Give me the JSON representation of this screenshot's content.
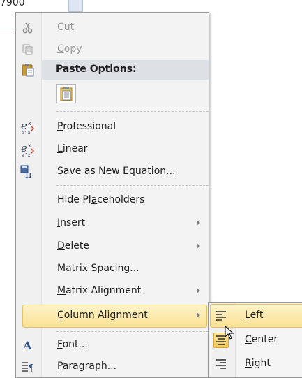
{
  "background": {
    "cell_text": "7900"
  },
  "menu": {
    "items": [
      {
        "id": "cut",
        "label": "Cut",
        "accel": "t",
        "disabled": true,
        "icon": "scissors-icon"
      },
      {
        "id": "copy",
        "label": "Copy",
        "accel": "C",
        "disabled": true,
        "icon": "copy-icon"
      },
      {
        "id": "paste_options",
        "label": "Paste Options:",
        "icon": "clipboard-icon"
      },
      {
        "id": "professional",
        "label": "Professional",
        "accel": "P",
        "icon": "equation-professional-icon"
      },
      {
        "id": "linear",
        "label": "Linear",
        "accel": "L",
        "icon": "equation-linear-icon"
      },
      {
        "id": "save_eq",
        "label": "Save as New Equation...",
        "accel": "S",
        "icon": "save-equation-icon"
      },
      {
        "id": "hide_placeholders",
        "label": "Hide Placeholders",
        "accel": "a"
      },
      {
        "id": "insert",
        "label": "Insert",
        "accel": "I",
        "submenu": true
      },
      {
        "id": "delete",
        "label": "Delete",
        "accel": "D",
        "submenu": true
      },
      {
        "id": "matrix_spacing",
        "label": "Matrix Spacing...",
        "accel": "x"
      },
      {
        "id": "matrix_alignment",
        "label": "Matrix Alignment",
        "accel": "M",
        "submenu": true
      },
      {
        "id": "column_alignment",
        "label": "Column Alignment",
        "accel": "C",
        "submenu": true,
        "highlighted": true
      },
      {
        "id": "font",
        "label": "Font...",
        "accel": "F",
        "icon": "font-icon"
      },
      {
        "id": "paragraph",
        "label": "Paragraph...",
        "accel": "P",
        "icon": "paragraph-icon"
      }
    ]
  },
  "submenu": {
    "items": [
      {
        "id": "left",
        "label": "Left",
        "accel": "L",
        "icon": "align-left-icon",
        "highlighted": true
      },
      {
        "id": "center",
        "label": "Center",
        "accel": "C",
        "icon": "align-center-icon",
        "checked": true
      },
      {
        "id": "right",
        "label": "Right",
        "accel": "R",
        "icon": "align-right-icon"
      }
    ]
  },
  "colors": {
    "highlight_top": "#fdf3c9",
    "highlight_bottom": "#fbe193",
    "menu_bg": "#f3f3f3"
  }
}
